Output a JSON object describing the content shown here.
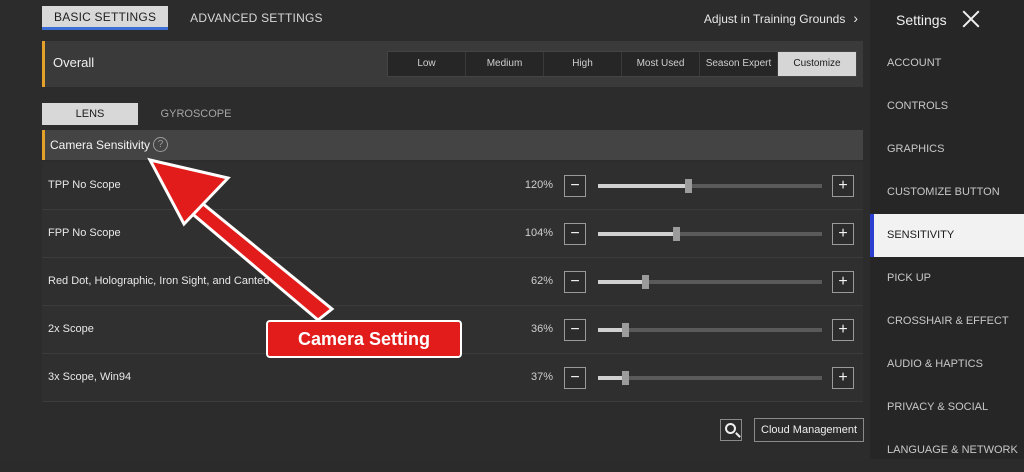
{
  "top_tabs": [
    {
      "label": "BASIC SETTINGS",
      "active": true
    },
    {
      "label": "ADVANCED SETTINGS",
      "active": false
    }
  ],
  "adjust_link": "Adjust in Training Grounds",
  "overall": {
    "label": "Overall",
    "presets": [
      "Low",
      "Medium",
      "High",
      "Most Used",
      "Season Expert",
      "Customize"
    ],
    "active_preset": "Customize"
  },
  "sub_tabs": [
    {
      "label": "LENS",
      "active": true
    },
    {
      "label": "GYROSCOPE",
      "active": false
    }
  ],
  "section_title": "Camera Sensitivity",
  "rows": [
    {
      "label": "TPP No Scope",
      "value": "120%",
      "level": 0.4
    },
    {
      "label": "FPP No Scope",
      "value": "104%",
      "level": 0.35
    },
    {
      "label": "Red Dot, Holographic, Iron Sight, and Canted Sig",
      "value": "62%",
      "level": 0.21
    },
    {
      "label": "2x Scope",
      "value": "36%",
      "level": 0.12
    },
    {
      "label": "3x Scope, Win94",
      "value": "37%",
      "level": 0.12
    }
  ],
  "cloud_label": "Cloud Management",
  "settings_title": "Settings",
  "menu": [
    {
      "label": "ACCOUNT",
      "active": false
    },
    {
      "label": "CONTROLS",
      "active": false
    },
    {
      "label": "GRAPHICS",
      "active": false
    },
    {
      "label": "CUSTOMIZE BUTTON",
      "active": false
    },
    {
      "label": "SENSITIVITY",
      "active": true
    },
    {
      "label": "PICK UP",
      "active": false
    },
    {
      "label": "CROSSHAIR & EFFECT",
      "active": false
    },
    {
      "label": "AUDIO & HAPTICS",
      "active": false
    },
    {
      "label": "PRIVACY & SOCIAL",
      "active": false
    },
    {
      "label": "LANGUAGE & NETWORK",
      "active": false
    }
  ],
  "annotation": "Camera Setting",
  "colors": {
    "accent_yellow": "#e4a12a",
    "annotation_red": "#e21b1b",
    "active_blue": "#2b3fd1"
  }
}
